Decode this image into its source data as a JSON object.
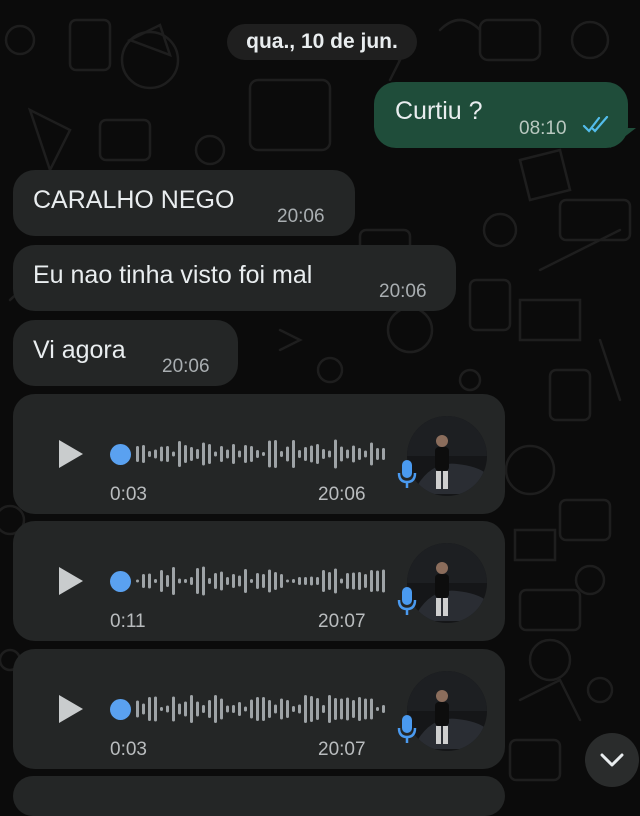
{
  "chat": {
    "date_label": "qua., 10 de jun.",
    "outgoing": [
      {
        "text": "Curtiu ?",
        "time": "08:10",
        "status": "read"
      }
    ],
    "incoming_text": [
      {
        "text": "CARALHO NEGO",
        "time": "20:06"
      },
      {
        "text": "Eu nao tinha visto foi mal",
        "time": "20:06"
      },
      {
        "text": "Vi agora",
        "time": "20:06"
      }
    ],
    "voice_messages": [
      {
        "duration": "0:03",
        "time": "20:06"
      },
      {
        "duration": "0:11",
        "time": "20:07"
      },
      {
        "duration": "0:03",
        "time": "20:07"
      }
    ]
  },
  "icons": {
    "play": "play-icon",
    "mic": "microphone-icon",
    "read": "double-check-icon",
    "scroll": "chevron-down-icon"
  },
  "colors": {
    "background": "#0b0b0b",
    "incoming_bubble": "#242626",
    "outgoing_bubble": "#1f4d3a",
    "read_tick": "#53bdeb",
    "voice_accent": "#5aa1f0"
  }
}
